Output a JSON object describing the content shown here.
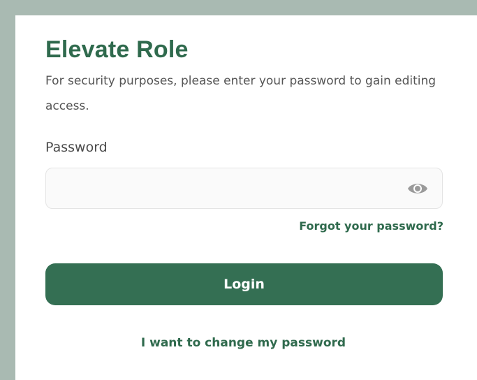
{
  "dialog": {
    "title": "Elevate Role",
    "subtitle": "For security purposes, please enter your password to gain editing access."
  },
  "password_field": {
    "label": "Password",
    "value": "",
    "placeholder": "",
    "toggle_icon": "eye-icon"
  },
  "links": {
    "forgot_password": "Forgot your password?",
    "change_password": "I want to change my password"
  },
  "buttons": {
    "login_label": "Login"
  },
  "colors": {
    "brand": "#2f6a4d",
    "button": "#346f53",
    "backdrop": "#a9bab2"
  }
}
